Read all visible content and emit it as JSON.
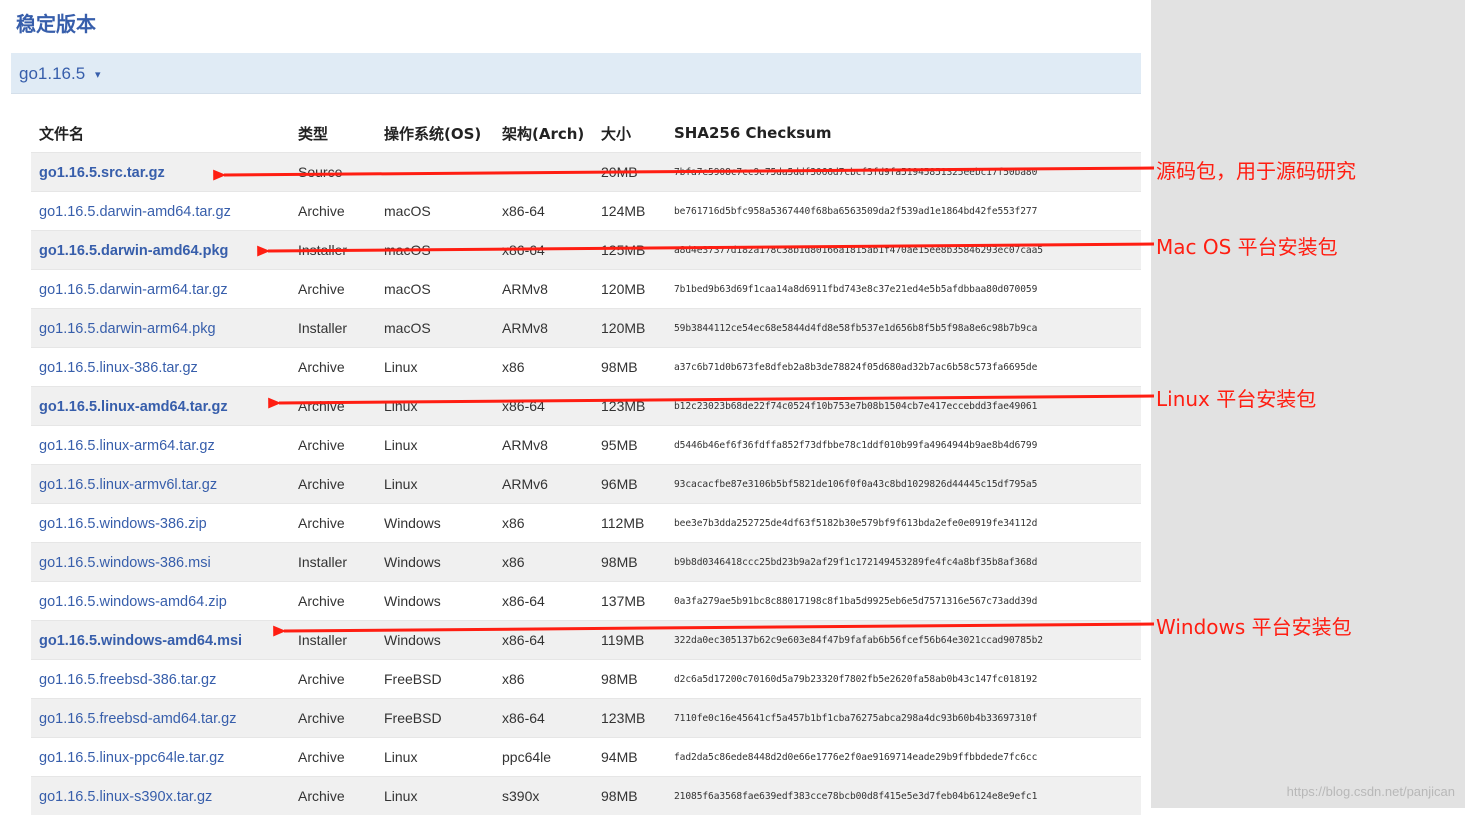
{
  "page": {
    "heading": "稳定版本",
    "version_toggle": "go1.16.5",
    "toggle_caret": "▾"
  },
  "table": {
    "headers": [
      "文件名",
      "类型",
      "操作系统(OS)",
      "架构(Arch)",
      "大小",
      "SHA256 Checksum"
    ],
    "rows": [
      {
        "file": "go1.16.5.src.tar.gz",
        "kind": "Source",
        "os": "",
        "arch": "",
        "size": "20MB",
        "checksum": "7bfa7e5908c7cc9e75da5ddf3066d7cbcf3fd9fa51945851325eebc17f50ba80",
        "highlight": true
      },
      {
        "file": "go1.16.5.darwin-amd64.tar.gz",
        "kind": "Archive",
        "os": "macOS",
        "arch": "x86-64",
        "size": "124MB",
        "checksum": "be761716d5bfc958a5367440f68ba6563509da2f539ad1e1864bd42fe553f277",
        "highlight": false
      },
      {
        "file": "go1.16.5.darwin-amd64.pkg",
        "kind": "Installer",
        "os": "macOS",
        "arch": "x86-64",
        "size": "125MB",
        "checksum": "a8d4e37377d182a178c38b1d80166a1815ab1f470ae15ee8b35846293ec07caa5",
        "highlight": true
      },
      {
        "file": "go1.16.5.darwin-arm64.tar.gz",
        "kind": "Archive",
        "os": "macOS",
        "arch": "ARMv8",
        "size": "120MB",
        "checksum": "7b1bed9b63d69f1caa14a8d6911fbd743e8c37e21ed4e5b5afdbbaa80d070059",
        "highlight": false
      },
      {
        "file": "go1.16.5.darwin-arm64.pkg",
        "kind": "Installer",
        "os": "macOS",
        "arch": "ARMv8",
        "size": "120MB",
        "checksum": "59b3844112ce54ec68e5844d4fd8e58fb537e1d656b8f5b5f98a8e6c98b7b9ca",
        "highlight": false
      },
      {
        "file": "go1.16.5.linux-386.tar.gz",
        "kind": "Archive",
        "os": "Linux",
        "arch": "x86",
        "size": "98MB",
        "checksum": "a37c6b71d0b673fe8dfeb2a8b3de78824f05d680ad32b7ac6b58c573fa6695de",
        "highlight": false
      },
      {
        "file": "go1.16.5.linux-amd64.tar.gz",
        "kind": "Archive",
        "os": "Linux",
        "arch": "x86-64",
        "size": "123MB",
        "checksum": "b12c23023b68de22f74c0524f10b753e7b08b1504cb7e417eccebdd3fae49061",
        "highlight": true
      },
      {
        "file": "go1.16.5.linux-arm64.tar.gz",
        "kind": "Archive",
        "os": "Linux",
        "arch": "ARMv8",
        "size": "95MB",
        "checksum": "d5446b46ef6f36fdffa852f73dfbbe78c1ddf010b99fa4964944b9ae8b4d6799",
        "highlight": false
      },
      {
        "file": "go1.16.5.linux-armv6l.tar.gz",
        "kind": "Archive",
        "os": "Linux",
        "arch": "ARMv6",
        "size": "96MB",
        "checksum": "93cacacfbe87e3106b5bf5821de106f0f0a43c8bd1029826d44445c15df795a5",
        "highlight": false
      },
      {
        "file": "go1.16.5.windows-386.zip",
        "kind": "Archive",
        "os": "Windows",
        "arch": "x86",
        "size": "112MB",
        "checksum": "bee3e7b3dda252725de4df63f5182b30e579bf9f613bda2efe0e0919fe34112d",
        "highlight": false
      },
      {
        "file": "go1.16.5.windows-386.msi",
        "kind": "Installer",
        "os": "Windows",
        "arch": "x86",
        "size": "98MB",
        "checksum": "b9b8d0346418ccc25bd23b9a2af29f1c172149453289fe4fc4a8bf35b8af368d",
        "highlight": false
      },
      {
        "file": "go1.16.5.windows-amd64.zip",
        "kind": "Archive",
        "os": "Windows",
        "arch": "x86-64",
        "size": "137MB",
        "checksum": "0a3fa279ae5b91bc8c88017198c8f1ba5d9925eb6e5d7571316e567c73add39d",
        "highlight": false
      },
      {
        "file": "go1.16.5.windows-amd64.msi",
        "kind": "Installer",
        "os": "Windows",
        "arch": "x86-64",
        "size": "119MB",
        "checksum": "322da0ec305137b62c9e603e84f47b9fafab6b56fcef56b64e3021ccad90785b2",
        "highlight": true
      },
      {
        "file": "go1.16.5.freebsd-386.tar.gz",
        "kind": "Archive",
        "os": "FreeBSD",
        "arch": "x86",
        "size": "98MB",
        "checksum": "d2c6a5d17200c70160d5a79b23320f7802fb5e2620fa58ab0b43c147fc018192",
        "highlight": false
      },
      {
        "file": "go1.16.5.freebsd-amd64.tar.gz",
        "kind": "Archive",
        "os": "FreeBSD",
        "arch": "x86-64",
        "size": "123MB",
        "checksum": "7110fe0c16e45641cf5a457b1bf1cba76275abca298a4dc93b60b4b33697310f",
        "highlight": false
      },
      {
        "file": "go1.16.5.linux-ppc64le.tar.gz",
        "kind": "Archive",
        "os": "Linux",
        "arch": "ppc64le",
        "size": "94MB",
        "checksum": "fad2da5c86ede8448d2d0e66e1776e2f0ae9169714eade29b9ffbbdede7fc6cc",
        "highlight": false
      },
      {
        "file": "go1.16.5.linux-s390x.tar.gz",
        "kind": "Archive",
        "os": "Linux",
        "arch": "s390x",
        "size": "98MB",
        "checksum": "21085f6a3568fae639edf383cce78bcb00d8f415e5e3d7feb04b6124e8e9efc1",
        "highlight": false
      }
    ]
  },
  "annotations": [
    {
      "text": "源码包，用于源码研究",
      "row": 0
    },
    {
      "text": "Mac OS 平台安装包",
      "row": 2
    },
    {
      "text": "Linux 平台安装包",
      "row": 6
    },
    {
      "text": "Windows 平台安装包",
      "row": 12
    }
  ],
  "annotation_color": "#ff1e12",
  "link_color": "#375eab",
  "watermark": "https://blog.csdn.net/panjican"
}
